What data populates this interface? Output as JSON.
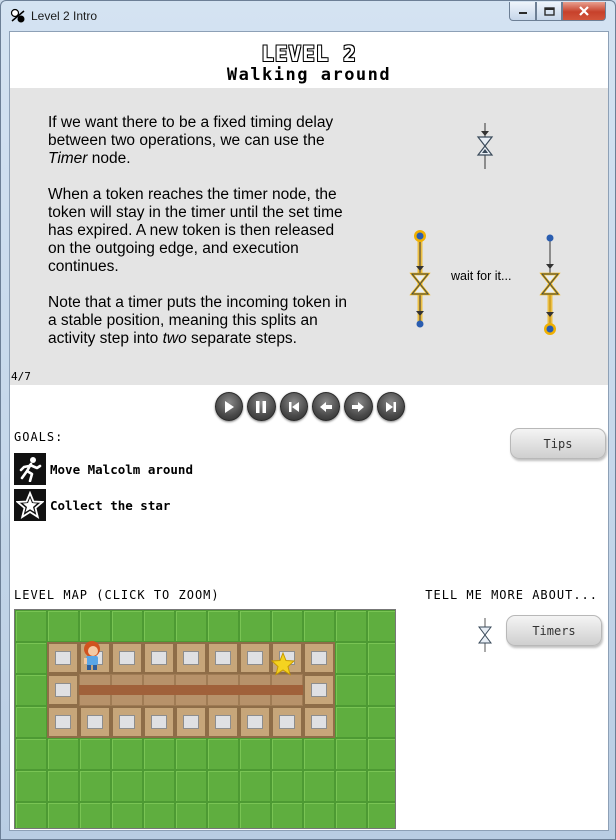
{
  "window": {
    "title": "Level 2 Intro"
  },
  "header": {
    "level_title": "LEVEL 2",
    "subtitle": "Walking around"
  },
  "intro": {
    "paragraph1_parts": [
      "If we want there to be a fixed timing delay between two operations, we can use the ",
      "Timer",
      " node."
    ],
    "paragraph2": "When a token reaches the timer node, the token will stay in the timer until the set time has expired. A new token is then released on the outgoing edge, and execution continues.",
    "paragraph3_parts": [
      "Note that a timer puts the incoming token in a stable position, meaning this splits an activity step into ",
      "two",
      " separate steps."
    ],
    "wait_label": "wait for it...",
    "page_counter": "4/7"
  },
  "controls": [
    "play",
    "pause",
    "skip-to-start",
    "step-back",
    "step-forward",
    "skip-to-end"
  ],
  "goals": {
    "heading": "GOALS:",
    "items": [
      {
        "icon": "running-man-icon",
        "label": "Move Malcolm around"
      },
      {
        "icon": "star-icon",
        "label": "Collect the star"
      }
    ],
    "tips_label": "Tips"
  },
  "map": {
    "heading": "LEVEL MAP (CLICK TO ZOOM)"
  },
  "tell_more": {
    "heading": "TELL ME MORE ABOUT...",
    "button_label": "Timers"
  },
  "colors": {
    "panel": "#e4e4e4",
    "highlight": "#f0b000",
    "grass": "#5fae3f",
    "wall": "#c7a67a"
  }
}
